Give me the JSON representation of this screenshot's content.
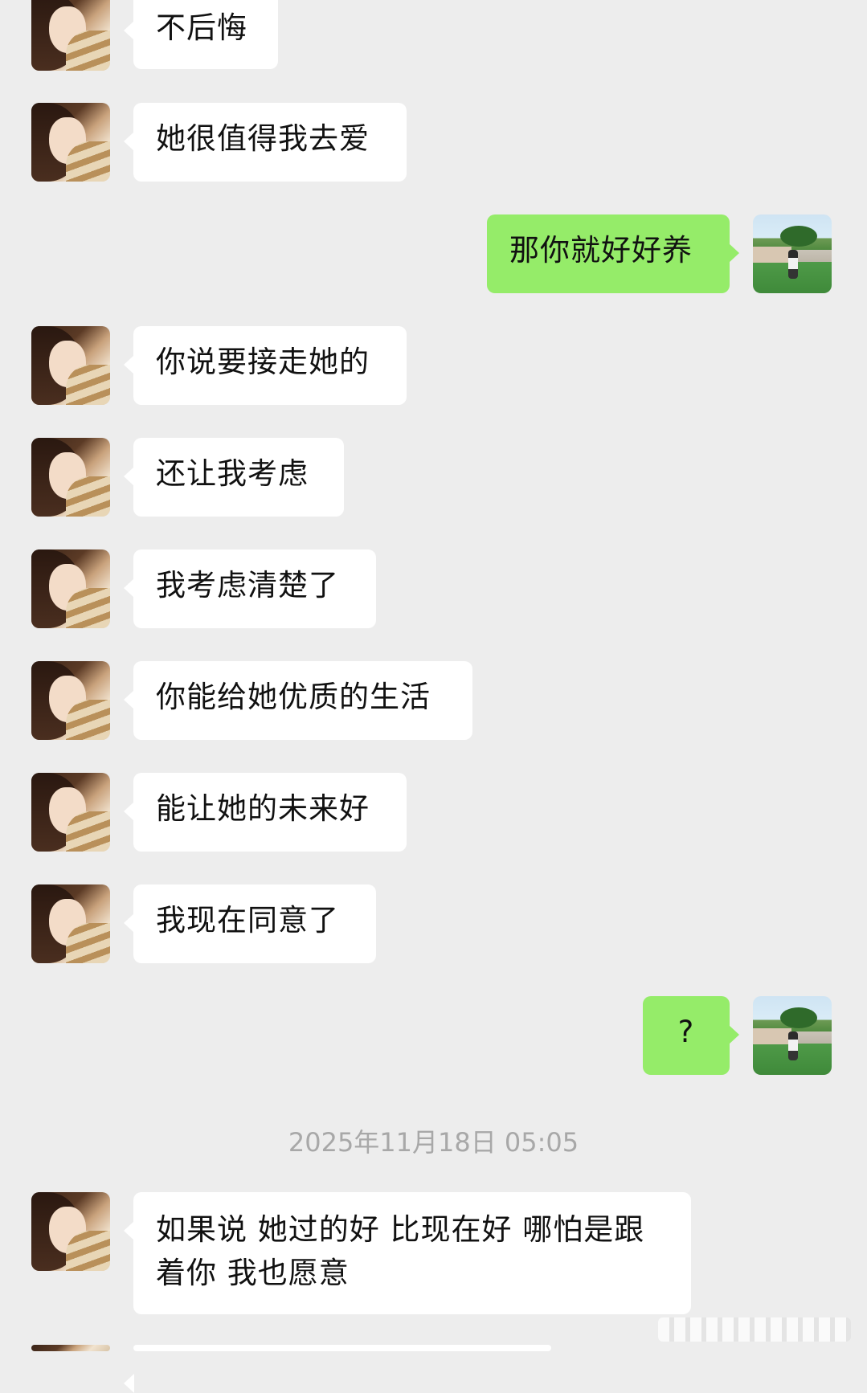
{
  "chat": {
    "messages": [
      {
        "side": "left",
        "text": "不后悔"
      },
      {
        "side": "left",
        "text": "她很值得我去爱"
      },
      {
        "side": "right",
        "text": "那你就好好养"
      },
      {
        "side": "left",
        "text": "你说要接走她的"
      },
      {
        "side": "left",
        "text": "还让我考虑"
      },
      {
        "side": "left",
        "text": "我考虑清楚了"
      },
      {
        "side": "left",
        "text": "你能给她优质的生活"
      },
      {
        "side": "left",
        "text": "能让她的未来好"
      },
      {
        "side": "left",
        "text": "我现在同意了"
      },
      {
        "side": "right",
        "text": "?"
      },
      {
        "side": "left",
        "text": "如果说 她过的好 比现在好 哪怕是跟着你 我也愿意"
      }
    ],
    "timestamp": "2025年11月18日 05:05"
  },
  "colors": {
    "background": "#ededed",
    "incoming_bubble": "#ffffff",
    "outgoing_bubble": "#95ec69",
    "timestamp_text": "#a8a8a8"
  },
  "icons": {
    "contact_avatar": "contact-avatar-icon",
    "user_avatar": "user-avatar-icon"
  }
}
